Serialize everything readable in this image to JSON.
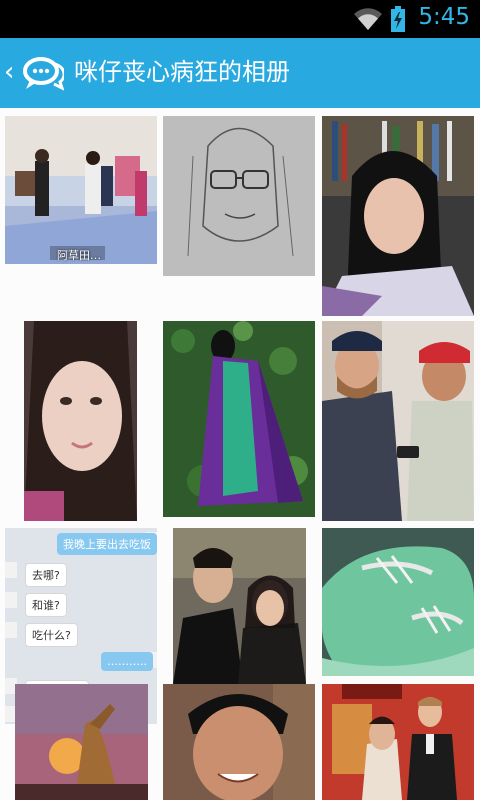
{
  "status_bar": {
    "time": "5:45"
  },
  "action_bar": {
    "back_glyph": "‹",
    "title": "咪仔丧心病狂的相册"
  },
  "photos": [
    {
      "name": "tv-show-dance",
      "caption": "阿草田…"
    },
    {
      "name": "sketch-portrait"
    },
    {
      "name": "bookshelf-selfie"
    },
    {
      "name": "closeup-selfie"
    },
    {
      "name": "purple-cape-ivy"
    },
    {
      "name": "caps-phone-friends"
    },
    {
      "name": "chat-screenshot",
      "messages": [
        "我晚上要出去吃饭",
        "去哪?",
        "和谁?",
        "吃什么?",
        "……….."
      ]
    },
    {
      "name": "couple-selfie"
    },
    {
      "name": "green-sneakers"
    },
    {
      "name": "giraffe-sunset"
    },
    {
      "name": "smiling-man"
    },
    {
      "name": "wedding-photo"
    }
  ]
}
